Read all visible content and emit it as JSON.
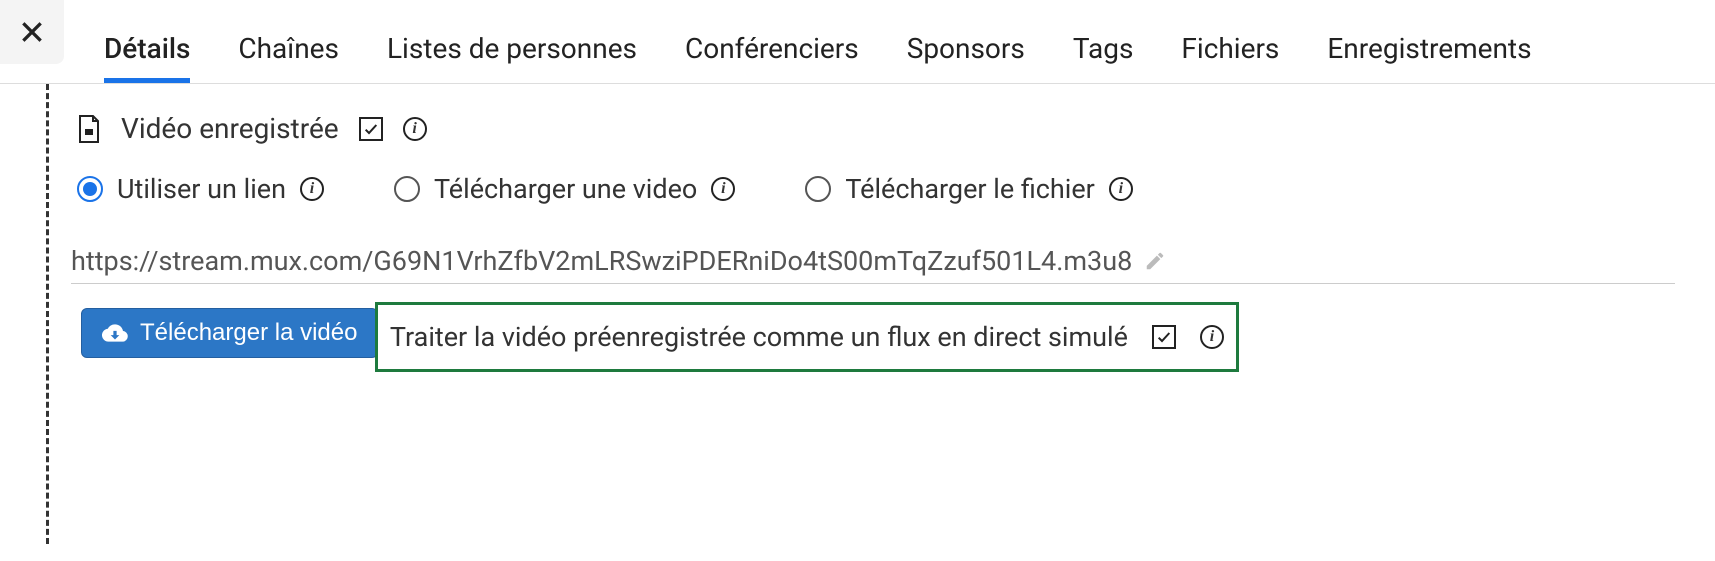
{
  "tabs": {
    "details": "Détails",
    "channels": "Chaînes",
    "people_lists": "Listes de personnes",
    "speakers": "Conférenciers",
    "sponsors": "Sponsors",
    "tags": "Tags",
    "files": "Fichiers",
    "recordings": "Enregistrements"
  },
  "section": {
    "recorded_video_label": "Vidéo enregistrée"
  },
  "radio": {
    "use_link": "Utiliser un lien",
    "upload_video": "Télécharger une video",
    "upload_file": "Télécharger le fichier"
  },
  "url": {
    "value": "https://stream.mux.com/G69N1VrhZfbV2mLRSwziPDERniDo4tS00mTqZzuf501L4.m3u8"
  },
  "download_button": "Télécharger la vidéo",
  "simulated_live": {
    "label": "Traiter la vidéo préenregistrée comme un flux en direct simulé"
  }
}
